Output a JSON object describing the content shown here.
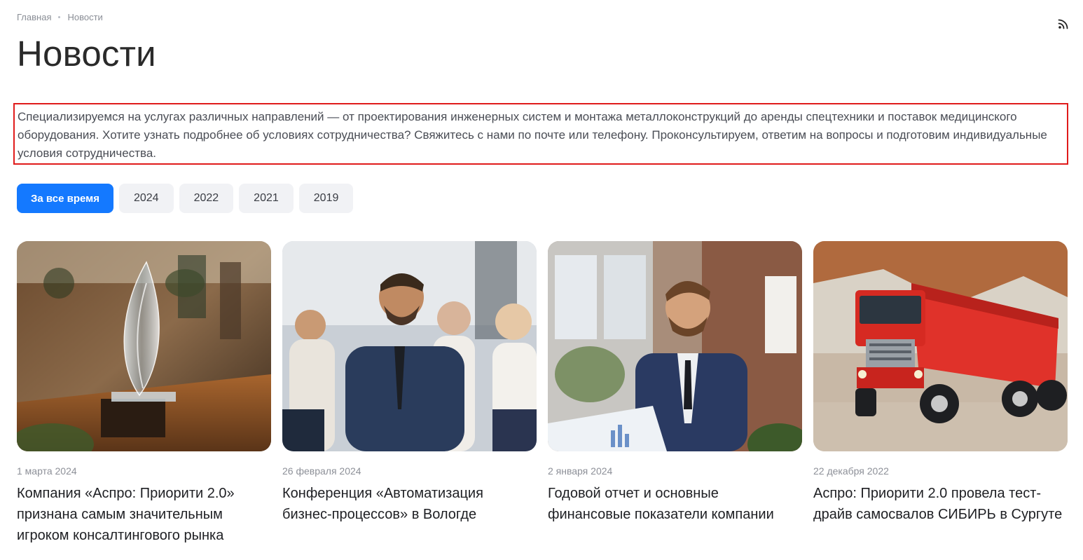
{
  "breadcrumb": {
    "home": "Главная",
    "current": "Новости"
  },
  "page": {
    "title": "Новости",
    "intro": "Специализируемся на услугах различных направлений — от проектирования инженерных систем и монтажа металлоконструкций до аренды спецтехники и поставок медицинского оборудования. Хотите узнать подробнее об условиях сотрудничества? Свяжитесь с нами по почте или телефону. Проконсультируем, ответим на вопросы и подготовим индивидуальные условия сотрудничества."
  },
  "filters": [
    {
      "label": "За все время",
      "active": true
    },
    {
      "label": "2024",
      "active": false
    },
    {
      "label": "2022",
      "active": false
    },
    {
      "label": "2021",
      "active": false
    },
    {
      "label": "2019",
      "active": false
    }
  ],
  "news": [
    {
      "date": "1 марта 2024",
      "title": "Компания «Аспро: Приорити 2.0» признана самым значительным игроком консалтингового рынка",
      "image": "glass-award-photo"
    },
    {
      "date": "26 февраля 2024",
      "title": "Конференция «Автоматизация бизнес-процессов» в Вологде",
      "image": "conference-audience-photo"
    },
    {
      "date": "2 января 2024",
      "title": "Годовой отчет и основные финансовые показатели компании",
      "image": "businessman-report-photo"
    },
    {
      "date": "22 декабря 2022",
      "title": "Аспро: Приорити 2.0 провела тест-драйв самосвалов СИБИРЬ в Сургуте",
      "image": "red-dump-truck-photo"
    }
  ],
  "colors": {
    "accent": "#1479ff",
    "highlight_border": "#e01b1b"
  },
  "icons": {
    "feed": "rss-icon"
  }
}
